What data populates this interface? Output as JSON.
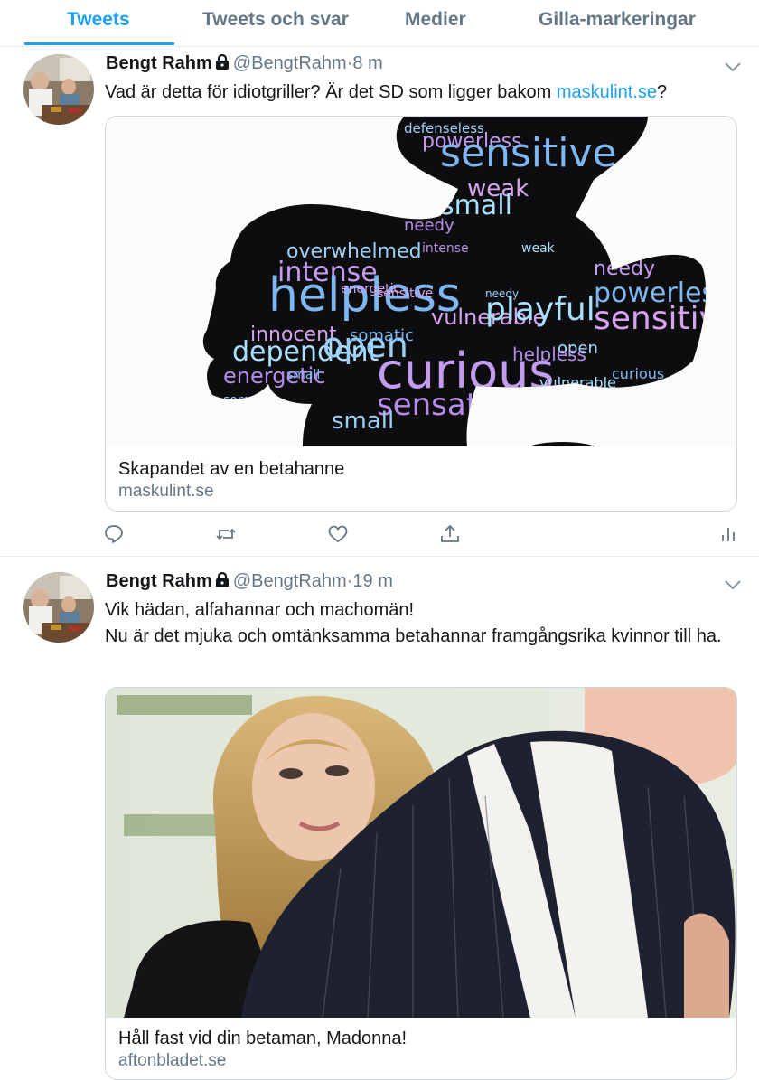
{
  "tabs": [
    {
      "label": "Tweets",
      "active": true
    },
    {
      "label": "Tweets och svar",
      "active": false
    },
    {
      "label": "Medier",
      "active": false
    },
    {
      "label": "Gilla-markeringar",
      "active": false
    }
  ],
  "colors": {
    "accent": "#1da1f2",
    "muted": "#657786",
    "border": "#e6ecf0"
  },
  "tweets": [
    {
      "author": "Bengt Rahm",
      "handle": "@BengtRahm",
      "separator": "·",
      "time": "8 m",
      "text_before": "Vad är detta för idiotgriller? Är det SD som ligger bakom ",
      "text_link": "maskulint.se",
      "text_after": "?",
      "card": {
        "title": "Skapandet av en betahanne",
        "domain": "maskulint.se"
      },
      "icons": [
        "reply-icon",
        "retweet-icon",
        "like-icon",
        "share-icon",
        "analytics-icon"
      ]
    },
    {
      "author": "Bengt Rahm",
      "handle": "@BengtRahm",
      "separator": "·",
      "time": "19 m",
      "line1": "Vik hädan, alfahannar och machomän!",
      "line2": "Nu är det mjuka och omtänksamma betahannar framgångsrika kvinnor till ha.",
      "card": {
        "title": "Håll fast vid din betaman, Madonna!",
        "domain": "aftonbladet.se"
      }
    }
  ],
  "wordcloud": {
    "words": [
      "defenseless",
      "powerless",
      "sensitive",
      "weak",
      "small",
      "needy",
      "overwhelmed",
      "intense",
      "helpless",
      "innocent",
      "dependent",
      "energetic",
      "open",
      "curious",
      "somatic",
      "vulnerable",
      "playful",
      "sensate",
      "small",
      "needy",
      "powerless",
      "sensitive",
      "open",
      "helpless",
      "somatic",
      "curious",
      "curious",
      "energetic",
      "weak",
      "intense",
      "needy",
      "defenseless",
      "small",
      "sensitive",
      "vulnerable",
      "intense",
      "small",
      "somatic",
      "open",
      "weak",
      "dependent"
    ]
  }
}
